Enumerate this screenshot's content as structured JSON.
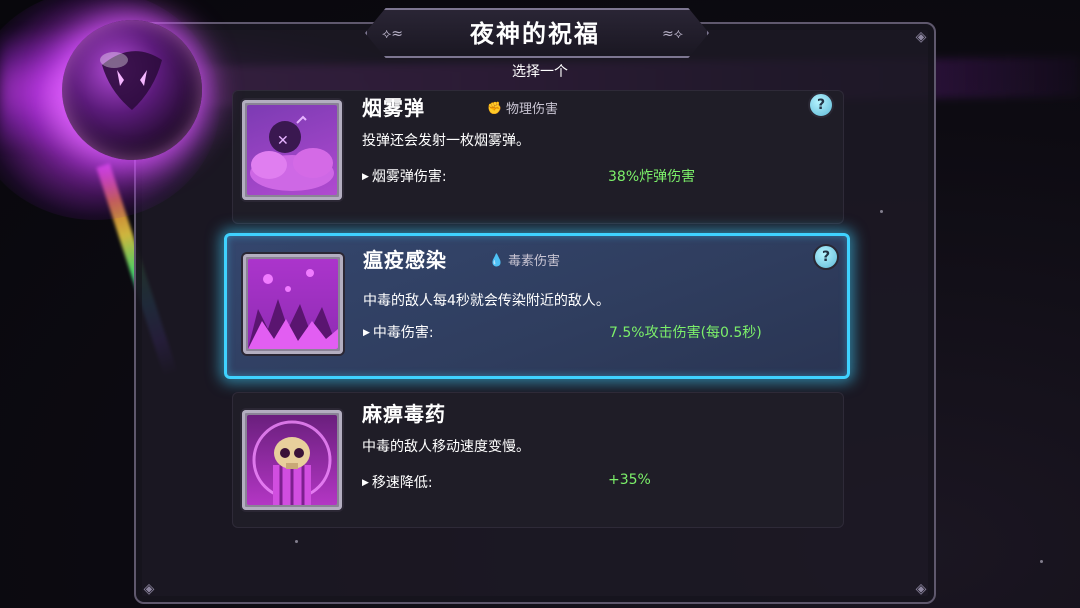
{
  "header": {
    "title": "夜神的祝福",
    "subtitle": "选择一个"
  },
  "cards": [
    {
      "name": "烟雾弹",
      "tag_icon": "fist-icon",
      "tag": "物理伤害",
      "help": "?",
      "description": "投弹还会发射一枚烟雾弹。",
      "stat_label": "烟雾弹伤害:",
      "stat_value": "38%炸弹伤害",
      "selected": false
    },
    {
      "name": "瘟疫感染",
      "tag_icon": "poison-drop-icon",
      "tag": "毒素伤害",
      "help": "?",
      "description": "中毒的敌人每4秒就会传染附近的敌人。",
      "stat_label": "中毒伤害:",
      "stat_value": "7.5%攻击伤害(每0.5秒)",
      "selected": true
    },
    {
      "name": "麻痹毒药",
      "description": "中毒的敌人移动速度变慢。",
      "stat_label": "移速降低:",
      "stat_value": "+35%",
      "selected": false
    }
  ],
  "colors": {
    "accent_selected": "#3fd2ff",
    "stat_value": "#7cf06a",
    "orb_glow": "#e650ff"
  }
}
